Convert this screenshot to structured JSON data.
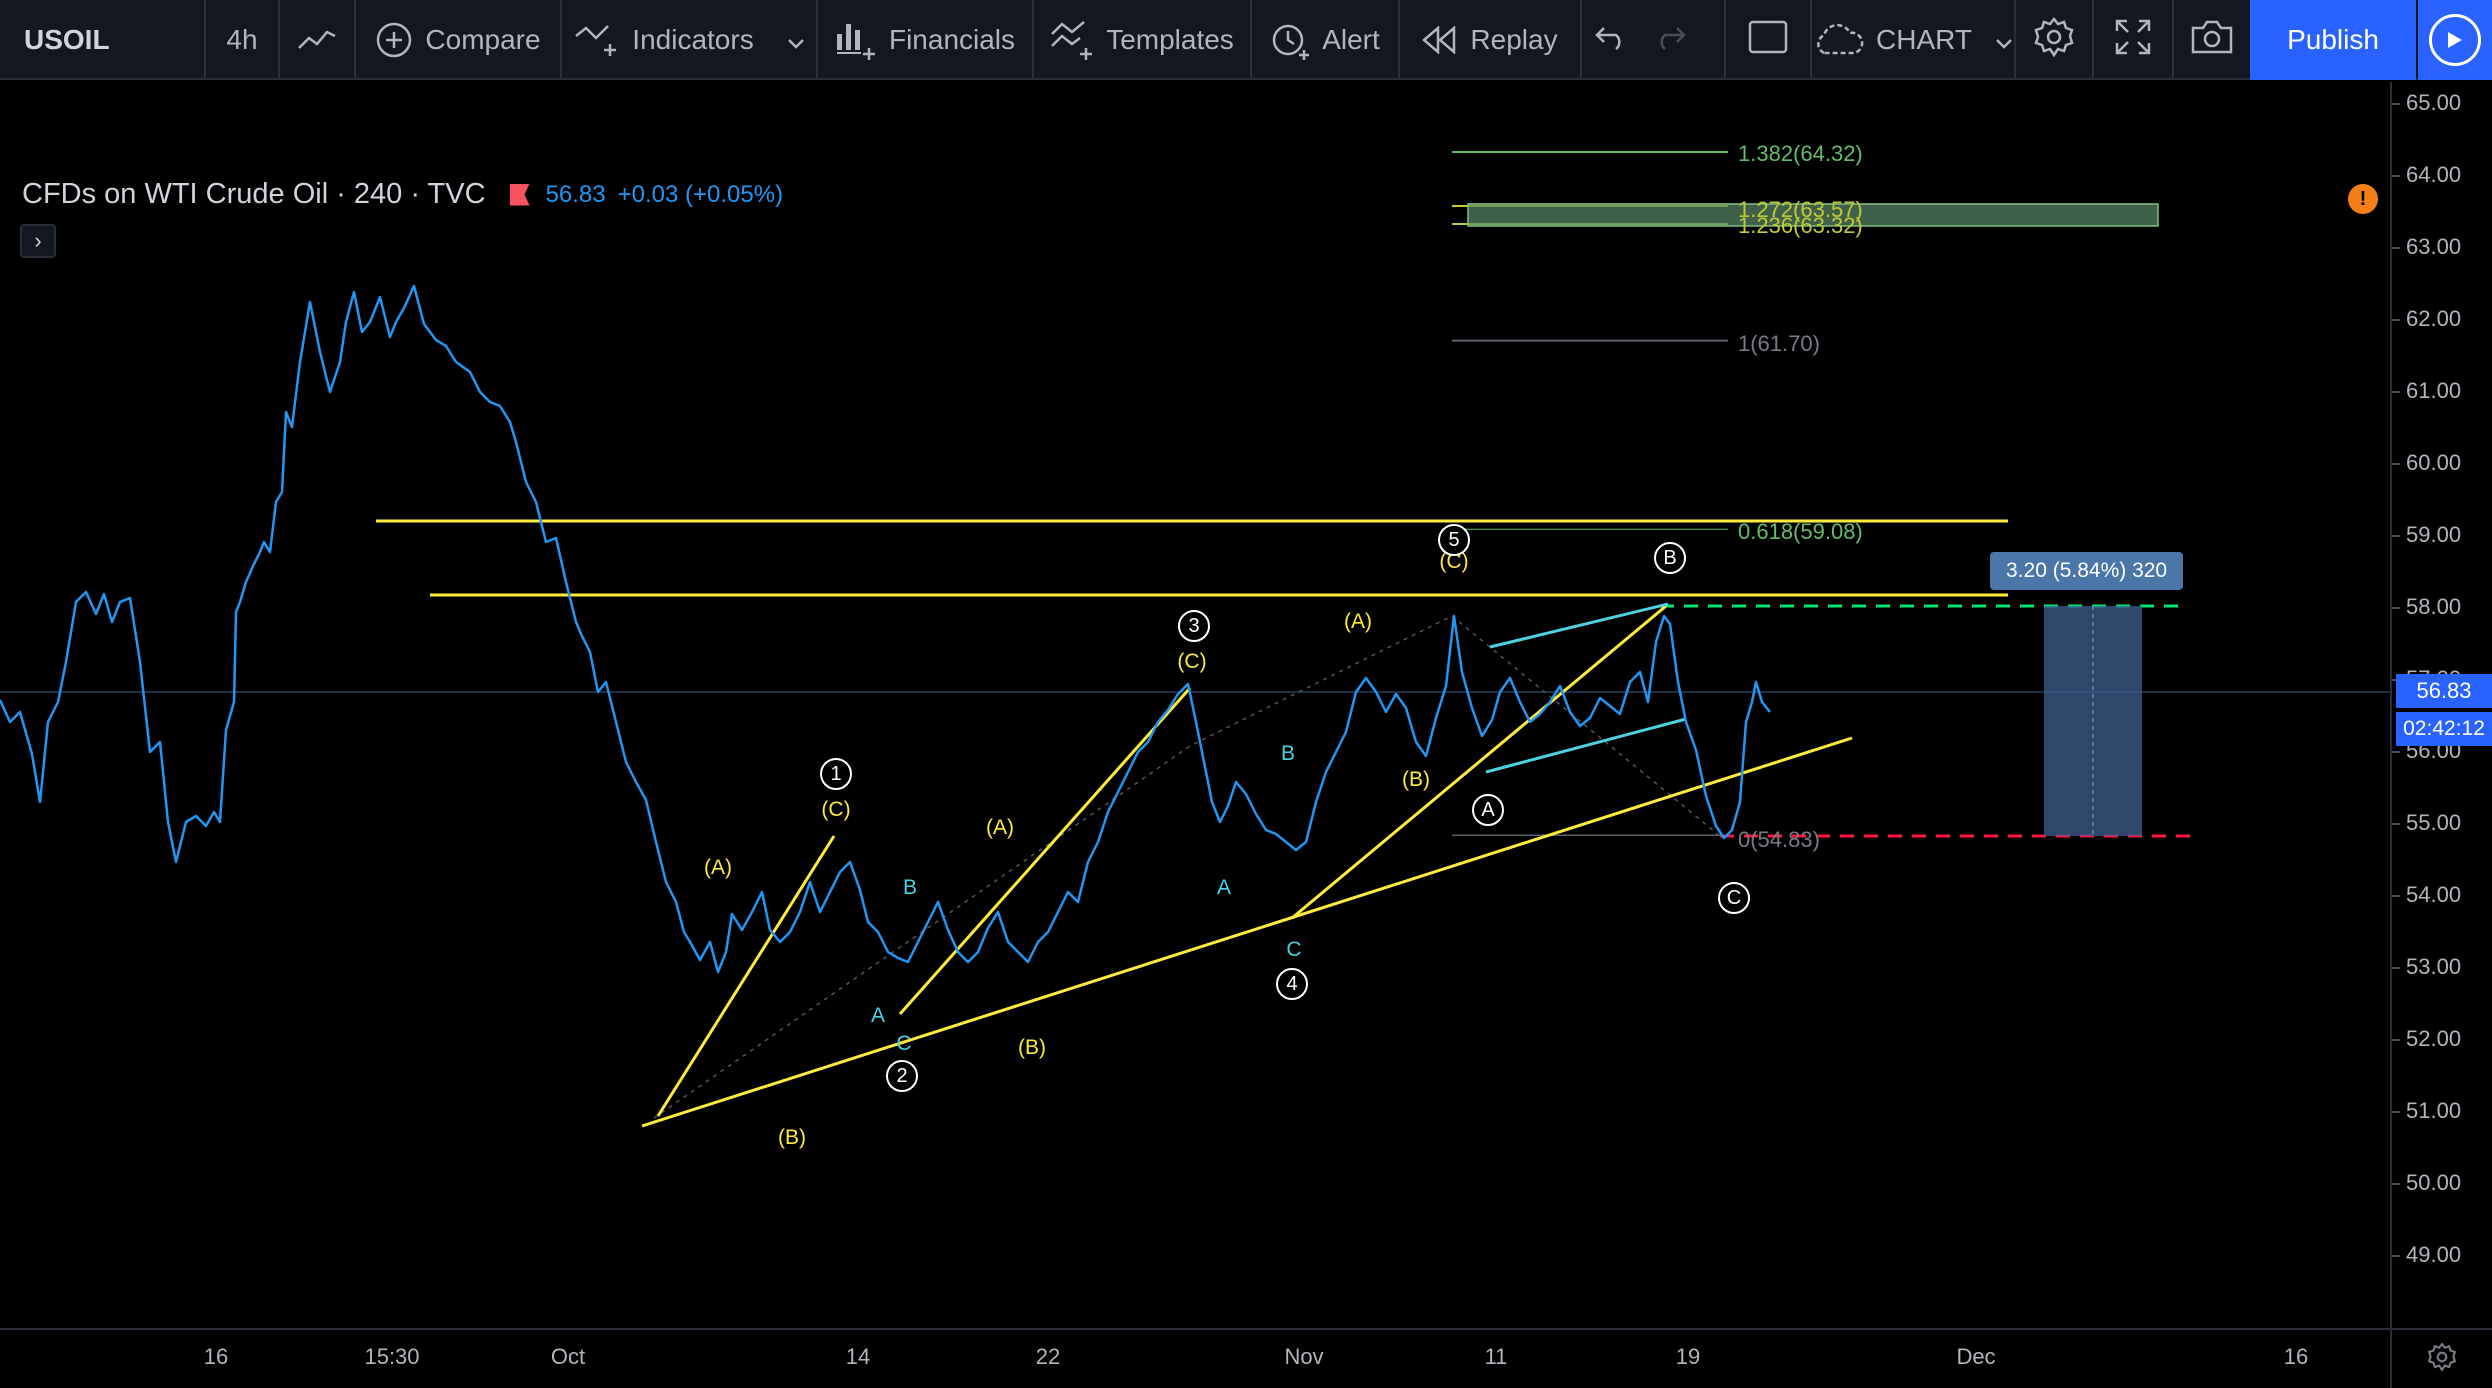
{
  "toolbar": {
    "symbol": "USOIL",
    "interval": "4h",
    "compare": "Compare",
    "indicators": "Indicators",
    "financials": "Financials",
    "templates": "Templates",
    "alert": "Alert",
    "replay": "Replay",
    "layout": "CHART",
    "publish": "Publish"
  },
  "legend": {
    "title": "CFDs on WTI Crude Oil · 240 · TVC",
    "price": "56.83",
    "change": "+0.03 (+0.05%)",
    "toggle": "›"
  },
  "price_scale": {
    "labels": [
      "65.00",
      "64.00",
      "63.00",
      "62.00",
      "61.00",
      "60.00",
      "59.00",
      "58.00",
      "57.00",
      "56.00",
      "55.00",
      "54.00",
      "53.00",
      "52.00",
      "51.00",
      "50.00",
      "49.00"
    ],
    "current_price": "56.83",
    "countdown": "02:42:12"
  },
  "time_scale": {
    "labels": [
      "16",
      "15:30",
      "Oct",
      "14",
      "22",
      "Nov",
      "11",
      "19",
      "Dec",
      "16"
    ]
  },
  "fibonacci": {
    "levels": [
      {
        "label": "1.382(64.32)",
        "color": "#66bb6a"
      },
      {
        "label": "1.272(63.57)",
        "color": "#c0ca33"
      },
      {
        "label": "1.236(63.32)",
        "color": "#c0ca33"
      },
      {
        "label": "1(61.70)",
        "color": "#787b86"
      },
      {
        "label": "0.618(59.08)",
        "color": "#66bb6a"
      },
      {
        "label": "0(54.83)",
        "color": "#787b86"
      }
    ]
  },
  "measure": {
    "label": "3.20 (5.84%) 320"
  },
  "wave_labels": {
    "yellow": [
      "(A)",
      "(C)",
      "(B)",
      "(A)",
      "(B)",
      "(C)",
      "(A)",
      "(B)",
      "(C)"
    ],
    "cyan": [
      "B",
      "A",
      "C",
      "B",
      "A",
      "C"
    ],
    "circled": [
      "1",
      "2",
      "3",
      "4",
      "5",
      "A",
      "B",
      "C"
    ]
  },
  "colors": {
    "price_line": "#2196f3",
    "trendline": "#ffeb3b",
    "channel": "#4dd0e1",
    "target_green": "#00e676",
    "stop_red": "#ff1744",
    "accent": "#2962ff"
  },
  "nav": {
    "zoom_out": "−",
    "zoom_in": "+",
    "scroll_left": "‹",
    "scroll_right": "›",
    "reset": "↻"
  }
}
